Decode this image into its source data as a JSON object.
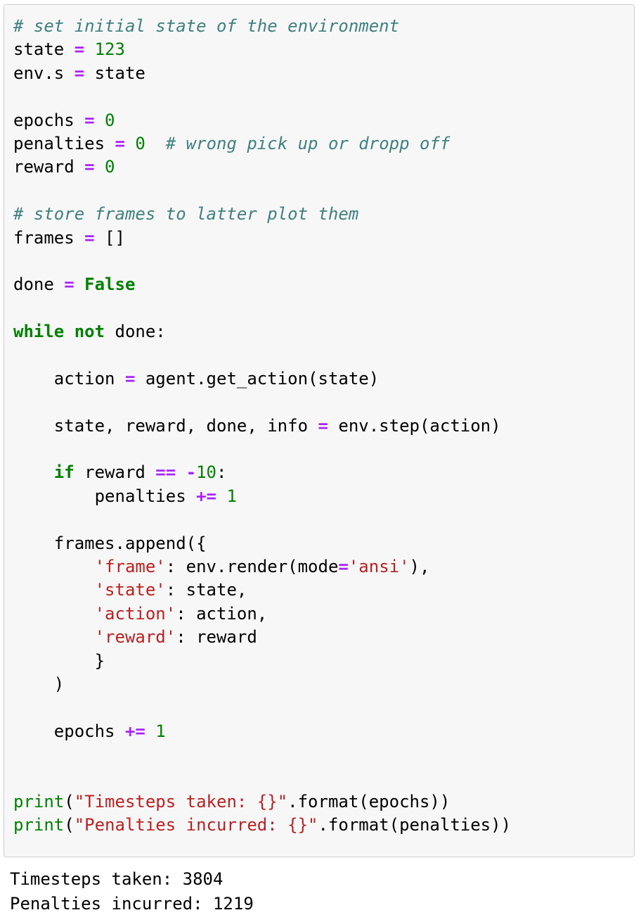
{
  "cell": {
    "type": "code-cell",
    "language": "python",
    "background_color": "#f7f7f7",
    "border_color": "#cfcfcf",
    "code_lines": [
      {
        "id": 1,
        "indent": 0,
        "tokens": [
          {
            "t": "cm",
            "v": "# set initial state of the environment"
          }
        ]
      },
      {
        "id": 2,
        "indent": 0,
        "tokens": [
          {
            "t": "pl",
            "v": "state "
          },
          {
            "t": "op",
            "v": "="
          },
          {
            "t": "nu",
            "v": " 123"
          }
        ]
      },
      {
        "id": 3,
        "indent": 0,
        "tokens": [
          {
            "t": "pl",
            "v": "env.s "
          },
          {
            "t": "op",
            "v": "="
          },
          {
            "t": "pl",
            "v": " state"
          }
        ]
      },
      {
        "id": 4,
        "indent": 0,
        "tokens": []
      },
      {
        "id": 5,
        "indent": 0,
        "tokens": [
          {
            "t": "pl",
            "v": "epochs "
          },
          {
            "t": "op",
            "v": "="
          },
          {
            "t": "nu",
            "v": " 0"
          }
        ]
      },
      {
        "id": 6,
        "indent": 0,
        "tokens": [
          {
            "t": "pl",
            "v": "penalties "
          },
          {
            "t": "op",
            "v": "="
          },
          {
            "t": "nu",
            "v": " 0"
          },
          {
            "t": "pl",
            "v": "  "
          },
          {
            "t": "cm",
            "v": "# wrong pick up or dropp off"
          }
        ]
      },
      {
        "id": 7,
        "indent": 0,
        "tokens": [
          {
            "t": "pl",
            "v": "reward "
          },
          {
            "t": "op",
            "v": "="
          },
          {
            "t": "nu",
            "v": " 0"
          }
        ]
      },
      {
        "id": 8,
        "indent": 0,
        "tokens": []
      },
      {
        "id": 9,
        "indent": 0,
        "tokens": [
          {
            "t": "cm",
            "v": "# store frames to latter plot them"
          }
        ]
      },
      {
        "id": 10,
        "indent": 0,
        "tokens": [
          {
            "t": "pl",
            "v": "frames "
          },
          {
            "t": "op",
            "v": "="
          },
          {
            "t": "pl",
            "v": " []"
          }
        ]
      },
      {
        "id": 11,
        "indent": 0,
        "tokens": []
      },
      {
        "id": 12,
        "indent": 0,
        "tokens": [
          {
            "t": "pl",
            "v": "done "
          },
          {
            "t": "op",
            "v": "="
          },
          {
            "t": "pl",
            "v": " "
          },
          {
            "t": "kw",
            "v": "False"
          }
        ]
      },
      {
        "id": 13,
        "indent": 0,
        "tokens": []
      },
      {
        "id": 14,
        "indent": 0,
        "tokens": [
          {
            "t": "kw",
            "v": "while not"
          },
          {
            "t": "pl",
            "v": " done:"
          }
        ]
      },
      {
        "id": 15,
        "indent": 0,
        "tokens": []
      },
      {
        "id": 16,
        "indent": 4,
        "tokens": [
          {
            "t": "pl",
            "v": "action "
          },
          {
            "t": "op",
            "v": "="
          },
          {
            "t": "pl",
            "v": " agent.get_action(state)"
          }
        ]
      },
      {
        "id": 17,
        "indent": 0,
        "tokens": []
      },
      {
        "id": 18,
        "indent": 4,
        "tokens": [
          {
            "t": "pl",
            "v": "state, reward, done, info "
          },
          {
            "t": "op",
            "v": "="
          },
          {
            "t": "pl",
            "v": " env.step(action)"
          }
        ]
      },
      {
        "id": 19,
        "indent": 0,
        "tokens": []
      },
      {
        "id": 20,
        "indent": 4,
        "tokens": [
          {
            "t": "kw",
            "v": "if"
          },
          {
            "t": "pl",
            "v": " reward "
          },
          {
            "t": "op",
            "v": "=="
          },
          {
            "t": "pl",
            "v": " "
          },
          {
            "t": "op",
            "v": "-"
          },
          {
            "t": "nu",
            "v": "10"
          },
          {
            "t": "pl",
            "v": ":"
          }
        ]
      },
      {
        "id": 21,
        "indent": 8,
        "tokens": [
          {
            "t": "pl",
            "v": "penalties "
          },
          {
            "t": "op",
            "v": "+="
          },
          {
            "t": "nu",
            "v": " 1"
          }
        ]
      },
      {
        "id": 22,
        "indent": 0,
        "tokens": []
      },
      {
        "id": 23,
        "indent": 4,
        "tokens": [
          {
            "t": "pl",
            "v": "frames.append({"
          }
        ]
      },
      {
        "id": 24,
        "indent": 8,
        "tokens": [
          {
            "t": "st",
            "v": "'frame'"
          },
          {
            "t": "pl",
            "v": ": env.render(mode"
          },
          {
            "t": "op",
            "v": "="
          },
          {
            "t": "st",
            "v": "'ansi'"
          },
          {
            "t": "pl",
            "v": "),"
          }
        ]
      },
      {
        "id": 25,
        "indent": 8,
        "tokens": [
          {
            "t": "st",
            "v": "'state'"
          },
          {
            "t": "pl",
            "v": ": state,"
          }
        ]
      },
      {
        "id": 26,
        "indent": 8,
        "tokens": [
          {
            "t": "st",
            "v": "'action'"
          },
          {
            "t": "pl",
            "v": ": action,"
          }
        ]
      },
      {
        "id": 27,
        "indent": 8,
        "tokens": [
          {
            "t": "st",
            "v": "'reward'"
          },
          {
            "t": "pl",
            "v": ": reward"
          }
        ]
      },
      {
        "id": 28,
        "indent": 8,
        "tokens": [
          {
            "t": "pl",
            "v": "}"
          }
        ]
      },
      {
        "id": 29,
        "indent": 4,
        "tokens": [
          {
            "t": "pl",
            "v": ")"
          }
        ]
      },
      {
        "id": 30,
        "indent": 0,
        "tokens": []
      },
      {
        "id": 31,
        "indent": 4,
        "tokens": [
          {
            "t": "pl",
            "v": "epochs "
          },
          {
            "t": "op",
            "v": "+="
          },
          {
            "t": "nu",
            "v": " 1"
          }
        ]
      },
      {
        "id": 32,
        "indent": 0,
        "tokens": []
      },
      {
        "id": 33,
        "indent": 0,
        "tokens": []
      },
      {
        "id": 34,
        "indent": 0,
        "tokens": [
          {
            "t": "bi",
            "v": "print"
          },
          {
            "t": "pl",
            "v": "("
          },
          {
            "t": "st",
            "v": "\"Timesteps taken: {}\""
          },
          {
            "t": "pl",
            "v": ".format(epochs))"
          }
        ]
      },
      {
        "id": 35,
        "indent": 0,
        "tokens": [
          {
            "t": "bi",
            "v": "print"
          },
          {
            "t": "pl",
            "v": "("
          },
          {
            "t": "st",
            "v": "\"Penalties incurred: {}\""
          },
          {
            "t": "pl",
            "v": ".format(penalties))"
          }
        ]
      }
    ]
  },
  "output": {
    "type": "stream",
    "lines": [
      "Timesteps taken: 3804",
      "Penalties incurred: 1219"
    ]
  },
  "results": {
    "timesteps_taken": 3804,
    "penalties_incurred": 1219
  },
  "colors": {
    "comment": "#408080",
    "operator": "#aa22ff",
    "number": "#008000",
    "keyword": "#008000",
    "string": "#ba2121",
    "builtin": "#008000",
    "plain": "#000000",
    "cell_background": "#f7f7f7",
    "cell_border": "#cfcfcf",
    "page_background": "#ffffff"
  }
}
